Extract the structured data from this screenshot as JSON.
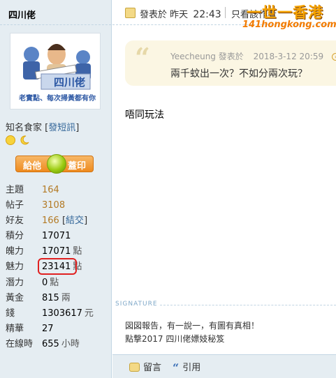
{
  "author": {
    "name": "四川佬",
    "avatar_banner": "四川佬",
    "avatar_caption": "老實點、每次掃黃都有你",
    "title": "知名食家",
    "sms_link": "發短訊",
    "medals": [
      "sun-medal",
      "moon-medal"
    ],
    "gift_button": {
      "left": "給他",
      "right": "蓋印"
    },
    "stats": [
      {
        "key": "主題",
        "value": "164",
        "unit": ""
      },
      {
        "key": "帖子",
        "value": "3108",
        "unit": ""
      },
      {
        "key": "好友",
        "value": "166",
        "unit": "",
        "bracket_link": "結交"
      },
      {
        "key": "積分",
        "value": "17071",
        "unit": ""
      },
      {
        "key": "魄力",
        "value": "17071",
        "unit": "點"
      },
      {
        "key": "魅力",
        "value": "23141",
        "unit": "點"
      },
      {
        "key": "潛力",
        "value": "0",
        "unit": "點"
      },
      {
        "key": "黃金",
        "value": "815",
        "unit": "兩"
      },
      {
        "key": "錢",
        "value": "1303617",
        "unit": "元"
      },
      {
        "key": "精華",
        "value": "27",
        "unit": ""
      },
      {
        "key": "在線時",
        "value": "655",
        "unit": "小時"
      }
    ]
  },
  "post_header": {
    "posted_label": "發表於",
    "posted_when": "昨天",
    "posted_time": "22:43",
    "only_view": "只看該作者"
  },
  "watermark": {
    "title": "一世一香港",
    "url": "141hongkong.com"
  },
  "quote": {
    "author": "Yeecheung",
    "posted_label": "發表於",
    "time": "2018-3-12 20:59",
    "text": "兩千蚊出一次？不如分兩次玩？"
  },
  "message": "唔同玩法",
  "signature": {
    "label": "SIGNATURE",
    "line1": "図図報告，有一說一，有圖有真相！",
    "line2": "點撃2017 四川佬嫖妓秘笈"
  },
  "actions": {
    "reply": "留言",
    "quote": "引用"
  },
  "colors": {
    "sidebar_bg": "#e5edf2",
    "quote_bg": "#fbf6e3",
    "gift_button": "#ee8a1e",
    "highlight_circle": "#e02020",
    "stat_value_link": "#b37a24"
  }
}
